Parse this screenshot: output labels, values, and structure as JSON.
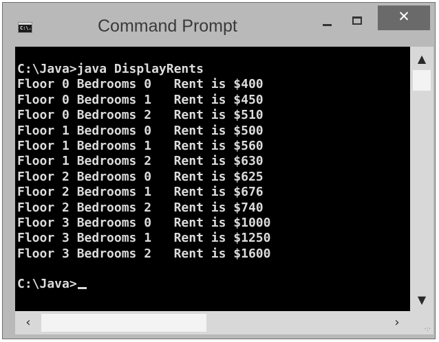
{
  "window": {
    "title": "Command Prompt",
    "icon": "cmd-icon",
    "icon_text": "C:\\.",
    "controls": {
      "minimize": "minimize-icon",
      "maximize": "maximize-icon",
      "close_glyph": "✕"
    }
  },
  "console": {
    "lines": [
      "C:\\Java>java DisplayRents",
      "Floor 0 Bedrooms 0   Rent is $400",
      "Floor 0 Bedrooms 1   Rent is $450",
      "Floor 0 Bedrooms 2   Rent is $510",
      "Floor 1 Bedrooms 0   Rent is $500",
      "Floor 1 Bedrooms 1   Rent is $560",
      "Floor 1 Bedrooms 2   Rent is $630",
      "Floor 2 Bedrooms 0   Rent is $625",
      "Floor 2 Bedrooms 1   Rent is $676",
      "Floor 2 Bedrooms 2   Rent is $740",
      "Floor 3 Bedrooms 0   Rent is $1000",
      "Floor 3 Bedrooms 1   Rent is $1250",
      "Floor 3 Bedrooms 2   Rent is $1600",
      "",
      "C:\\Java>"
    ],
    "colors": {
      "background": "#000000",
      "text": "#dcdcdc"
    }
  },
  "scrollbars": {
    "vertical": {
      "up": "▲",
      "down": "▼"
    },
    "horizontal": {
      "left": "‹",
      "right": "›"
    }
  }
}
